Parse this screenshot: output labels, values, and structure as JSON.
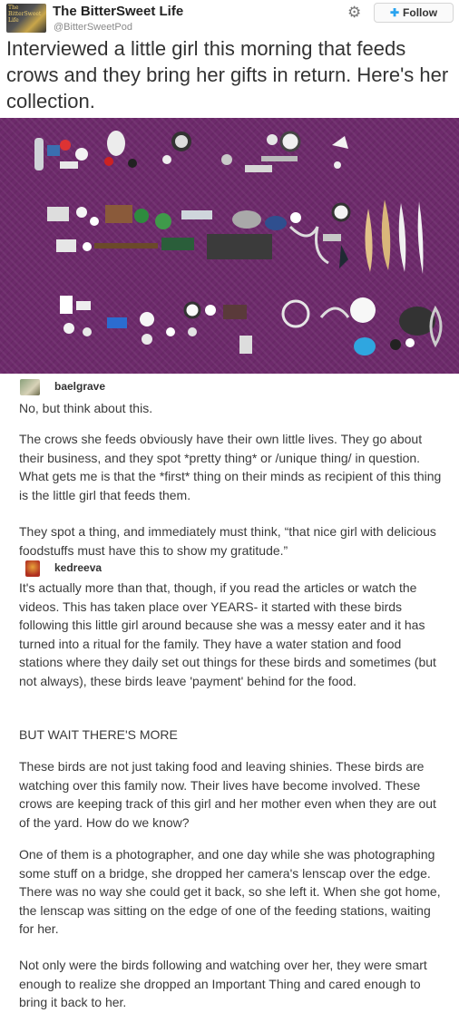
{
  "tweet": {
    "display_name": "The BitterSweet Life",
    "handle": "@BitterSweetPod",
    "avatar_text": "The BitterSweet Life",
    "follow_label": "Follow",
    "text": "Interviewed a little girl this morning that feeds crows and they bring her gifts in return. Here's her collection."
  },
  "icons": {
    "settings": "gear-icon",
    "follow": "add-person-icon"
  },
  "colors": {
    "photo_background": "#6d2a6b",
    "follow_icon": "#2aa3ef"
  },
  "comments": [
    {
      "username": "baelgrave",
      "paragraphs": [
        "No, but think about this.",
        "The crows she feeds obviously have their own little lives. They go about their business, and they spot *pretty thing* or /unique thing/ in question. What gets me is that the *first* thing on their minds as recipient of this thing is the little girl that feeds them.",
        "They spot a thing, and immediately must think, “that nice girl with delicious foodstuffs must have this to show my gratitude.”"
      ]
    },
    {
      "username": "kedreeva",
      "paragraphs": [
        "It's actually more than that, though, if you read the articles or watch the videos. This has taken place over YEARS- it started with these birds following this little girl around because she was a messy eater and it has turned into a ritual for the family. They have a water station and food stations where they daily set out things for these birds and sometimes (but not always), these birds leave 'payment' behind for the food.",
        "BUT WAIT THERE'S MORE",
        "These birds are not just taking food and leaving shinies. These birds are watching over this family now. Their lives have become involved. These crows are keeping track of this girl and her mother even when they are out of the yard. How do we know?",
        "One of them is a photographer, and one day while she was photographing some stuff on a bridge, she dropped her camera's lenscap over the edge. There was no way she could get it back, so she left it. When she got home, the lenscap was sitting on the edge of one of the feeding stations, waiting for her.",
        "Not only were the birds following and watching over her, they were smart enough to realize she dropped an Important Thing and cared enough to bring it back to her."
      ]
    }
  ]
}
